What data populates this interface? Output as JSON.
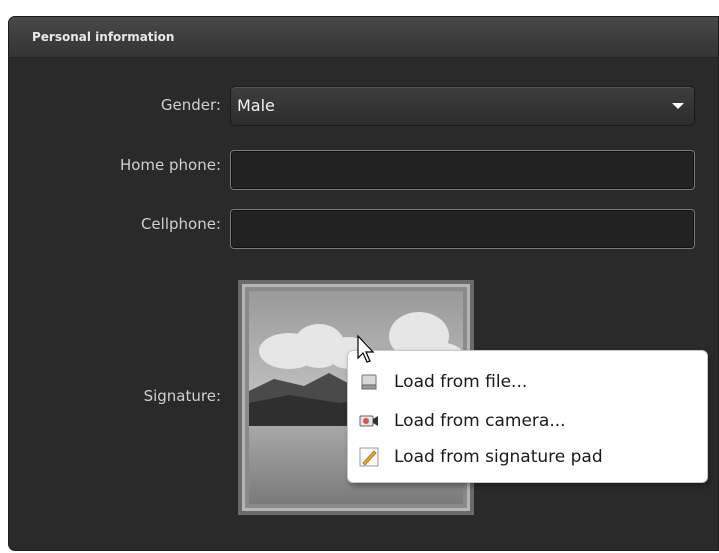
{
  "panel": {
    "title": "Personal information"
  },
  "form": {
    "gender": {
      "label": "Gender:",
      "value": "Male"
    },
    "home_phone": {
      "label": "Home phone:",
      "value": ""
    },
    "cellphone": {
      "label": "Cellphone:",
      "value": ""
    },
    "signature": {
      "label": "Signature:"
    }
  },
  "context_menu": {
    "items": [
      {
        "label": "Load from file...",
        "icon": "file-icon"
      },
      {
        "label": "Load from camera...",
        "icon": "camera-icon"
      },
      {
        "label": "Load from signature pad",
        "icon": "signature-pad-icon"
      }
    ]
  },
  "colors": {
    "panel_background": "#2a2a2a",
    "header_background": "#404040",
    "menu_background": "#ffffff"
  }
}
